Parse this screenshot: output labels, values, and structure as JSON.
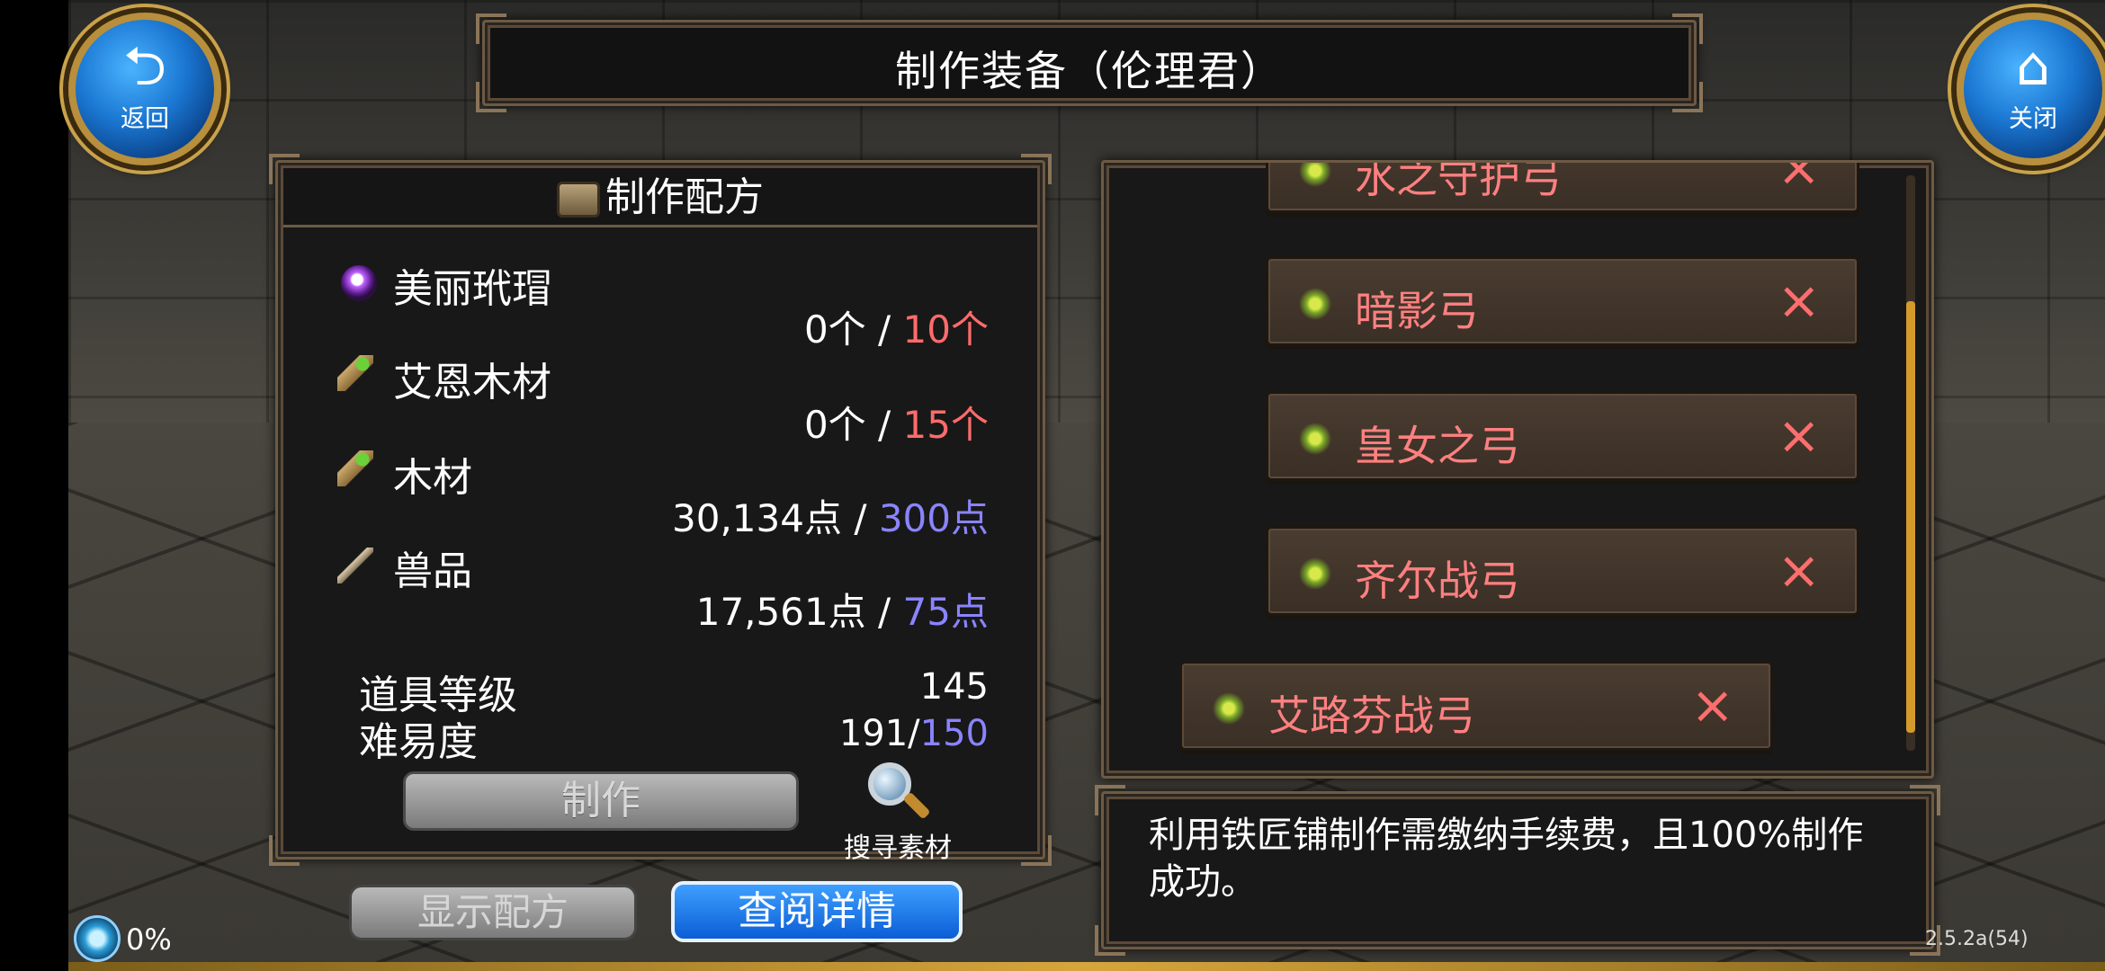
{
  "header": {
    "title": "制作装备（伦理君）"
  },
  "back_button": {
    "label": "返回",
    "icon": "back-arrow-icon"
  },
  "close_button": {
    "label": "关闭",
    "icon": "home-icon"
  },
  "recipe": {
    "title": "制作配方",
    "materials": [
      {
        "name": "美丽玳瑁",
        "icon": "orb-icon",
        "have": "0个",
        "need": "10个",
        "need_color": "#ff6b6b"
      },
      {
        "name": "艾恩木材",
        "icon": "wood-icon",
        "have": "0个",
        "need": "15个",
        "need_color": "#ff6b6b"
      },
      {
        "name": "木材",
        "icon": "wood-icon",
        "have": "30,134点",
        "need": "300点",
        "need_color": "#8a84ff"
      },
      {
        "name": "兽品",
        "icon": "fang-icon",
        "have": "17,561点",
        "need": "75点",
        "need_color": "#8a84ff"
      }
    ],
    "item_level_label": "道具等级",
    "item_level_value": "145",
    "difficulty_label": "难易度",
    "difficulty_current": "191/",
    "difficulty_max": "150",
    "make_button": "制作",
    "search_label": "搜寻素材"
  },
  "buttons": {
    "show_recipe": "显示配方",
    "view_details": "查阅详情"
  },
  "list": {
    "items": [
      {
        "name": "水之守护弓",
        "icon": "bow-icon",
        "status": "×"
      },
      {
        "name": "暗影弓",
        "icon": "bow-icon",
        "status": "×"
      },
      {
        "name": "皇女之弓",
        "icon": "bow-icon",
        "status": "×"
      },
      {
        "name": "齐尔战弓",
        "icon": "bow-icon",
        "status": "×"
      },
      {
        "name": "艾路芬战弓",
        "icon": "bow-icon",
        "status": "×"
      }
    ]
  },
  "info": {
    "text": "利用铁匠铺制作需缴纳手续费，且100%制作成功。"
  },
  "status": {
    "progress": "0%",
    "version": "2.5.2a(54)"
  },
  "colors": {
    "accent_blue": "#1a76d1",
    "frame_gold": "#b78f3d",
    "item_red": "#ff8080",
    "quantity_blue": "#8a84ff"
  }
}
